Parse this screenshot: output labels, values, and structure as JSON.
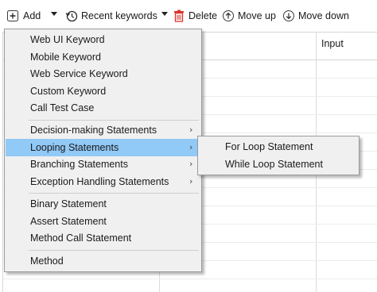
{
  "toolbar": {
    "add_label": "Add",
    "recent_label": "Recent keywords",
    "delete_label": "Delete",
    "move_up_label": "Move up",
    "move_down_label": "Move down"
  },
  "table": {
    "column_header": "Input"
  },
  "menu": {
    "items": [
      {
        "label": "Web UI Keyword",
        "submenu": false
      },
      {
        "label": "Mobile Keyword",
        "submenu": false
      },
      {
        "label": "Web Service Keyword",
        "submenu": false
      },
      {
        "label": "Custom Keyword",
        "submenu": false
      },
      {
        "label": "Call Test Case",
        "submenu": false
      },
      {
        "label": "Decision-making Statements",
        "submenu": true
      },
      {
        "label": "Looping Statements",
        "submenu": true,
        "highlighted": true
      },
      {
        "label": "Branching Statements",
        "submenu": true
      },
      {
        "label": "Exception Handling Statements",
        "submenu": true
      },
      {
        "label": "Binary Statement",
        "submenu": false
      },
      {
        "label": "Assert Statement",
        "submenu": false
      },
      {
        "label": "Method Call Statement",
        "submenu": false
      },
      {
        "label": "Method",
        "submenu": false
      }
    ],
    "arrow_glyph": "›"
  },
  "submenu": {
    "items": [
      {
        "label": "For Loop Statement"
      },
      {
        "label": "While Loop Statement"
      }
    ]
  },
  "colors": {
    "highlight": "#91c9f7",
    "menu_bg": "#f0f0f0",
    "delete_icon": "#d9342b"
  }
}
